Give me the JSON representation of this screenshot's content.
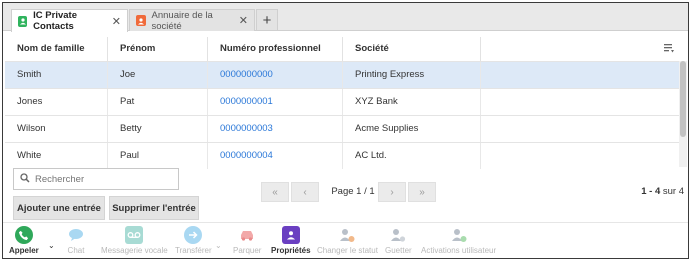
{
  "tabs": [
    {
      "label": "IC Private Contacts",
      "icon": "contacts-book-icon",
      "color": "#2fb35d",
      "active": true
    },
    {
      "label": "Annuaire de la société",
      "icon": "company-directory-icon",
      "color": "#f06a3a",
      "active": false
    }
  ],
  "add_tab": "+",
  "close_symbol": "✕",
  "table": {
    "headers": [
      "Nom de famille",
      "Prénom",
      "Numéro professionnel",
      "Société",
      ""
    ],
    "rows": [
      {
        "last": "Smith",
        "first": "Joe",
        "phone": "0000000000",
        "company": "Printing Express",
        "selected": true
      },
      {
        "last": "Jones",
        "first": "Pat",
        "phone": "0000000001",
        "company": "XYZ Bank",
        "selected": false
      },
      {
        "last": "Wilson",
        "first": "Betty",
        "phone": "0000000003",
        "company": "Acme Supplies",
        "selected": false
      },
      {
        "last": "White",
        "first": "Paul",
        "phone": "0000000004",
        "company": "AC Ltd.",
        "selected": false
      }
    ]
  },
  "search": {
    "placeholder": "Rechercher"
  },
  "pager": {
    "first": "«",
    "prev": "‹",
    "page_text": "Page 1 / 1",
    "next": "›",
    "last": "»",
    "range": "1 - 4",
    "total_text": " sur 4"
  },
  "actions": {
    "add": "Ajouter une entrée",
    "delete": "Supprimer l'entrée"
  },
  "toolbar": [
    {
      "label": "Appeler",
      "icon": "phone-icon",
      "enabled": true
    },
    {
      "label": "Chat",
      "icon": "chat-icon",
      "enabled": false
    },
    {
      "label": "Messagerie vocale",
      "icon": "voicemail-icon",
      "enabled": false
    },
    {
      "label": "Transférer",
      "icon": "transfer-icon",
      "enabled": false
    },
    {
      "label": "Parquer",
      "icon": "park-car-icon",
      "enabled": false
    },
    {
      "label": "Propriétés",
      "icon": "properties-icon",
      "enabled": true
    },
    {
      "label": "Changer le statut",
      "icon": "change-status-icon",
      "enabled": false
    },
    {
      "label": "Guetter",
      "icon": "watch-icon",
      "enabled": false
    },
    {
      "label": "Activations utilisateur",
      "icon": "user-activations-icon",
      "enabled": false
    }
  ],
  "colors": {
    "accent": "#2b78d8",
    "selected_row": "#dde9f7",
    "call_green": "#2fa85a",
    "properties_purple": "#6a3fc1"
  }
}
